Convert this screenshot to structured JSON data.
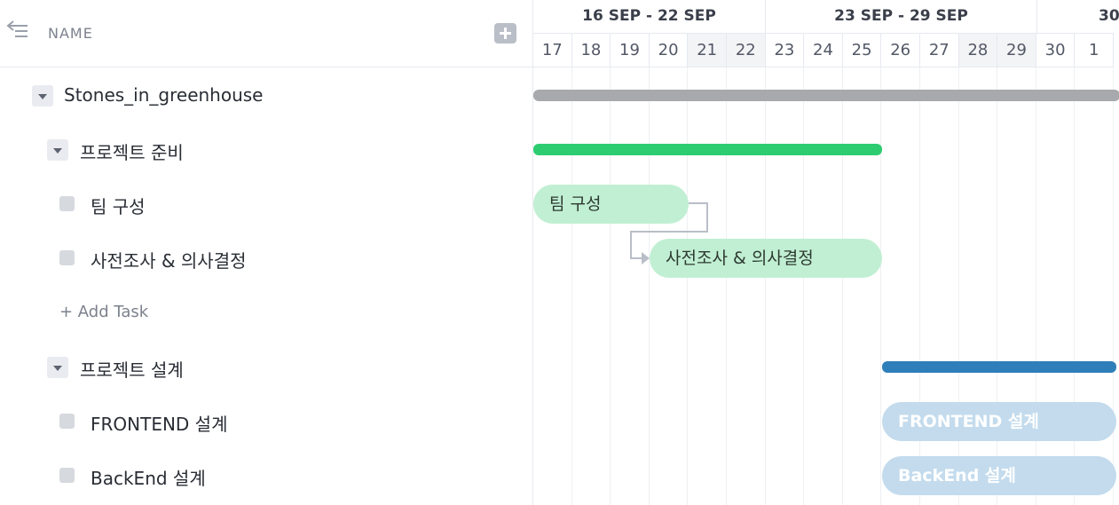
{
  "header": {
    "name_label": "NAME"
  },
  "tree": {
    "project": "Stones_in_greenhouse",
    "group1": "프로젝트 준비",
    "task1": "팀 구성",
    "task2": "사전조사 & 의사결정",
    "add_task": "+ Add Task",
    "group2": "프로젝트 설계",
    "task3": "FRONTEND 설계",
    "task4": "BackEnd 설계"
  },
  "timeline": {
    "weeks": [
      "16 SEP - 22 SEP",
      "23 SEP - 29 SEP",
      "30"
    ],
    "days": [
      "17",
      "18",
      "19",
      "20",
      "21",
      "22",
      "23",
      "24",
      "25",
      "26",
      "27",
      "28",
      "29",
      "30",
      "1"
    ],
    "weekend_days": [
      "21",
      "22",
      "28",
      "29"
    ]
  },
  "gantt": {
    "task1_label": "팀 구성",
    "task2_label": "사전조사 & 의사결정",
    "task3_label": "FRONTEND 설계",
    "task4_label": "BackEnd 설계"
  },
  "colors": {
    "project_bar": "#a7a9ac",
    "group1_bar": "#2ecc71",
    "group2_bar": "#2e7fb9",
    "task_green": "#c1efd3",
    "task_blue": "#c3dbed"
  },
  "icons": {
    "back": "arrow-left-lines-icon",
    "add": "plus-square-icon"
  }
}
